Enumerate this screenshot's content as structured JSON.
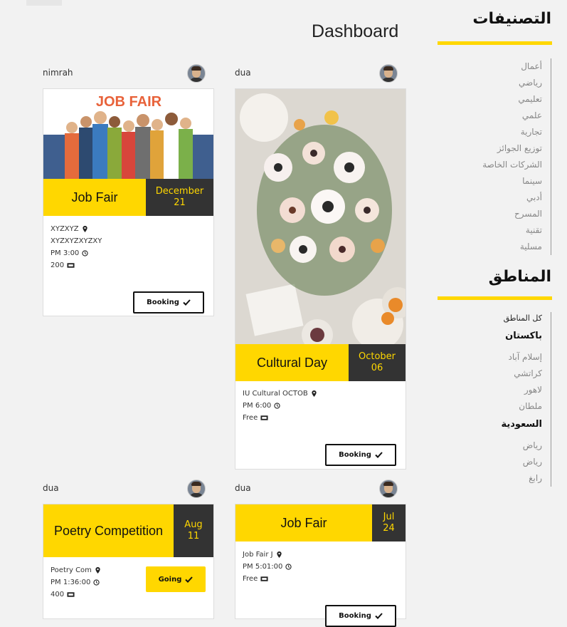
{
  "page": {
    "title": "Dashboard"
  },
  "sidebar": {
    "categories_heading": "التصنيفات",
    "categories": [
      "أعمال",
      "رياضي",
      "تعليمي",
      "علمي",
      "تجارية",
      "توزيع الجوائز",
      "الشركات الخاصة",
      "سينما",
      "أدبي",
      "المسرح",
      "تقنية",
      "مسلية"
    ],
    "regions_heading": "المناطق",
    "all_regions": "كل المناطق",
    "pakistan": "باكستان",
    "pakistan_cities": [
      "إسلام آباد",
      "كراتشي",
      "لاهور",
      "ملطان"
    ],
    "saudi": "السعودية",
    "saudi_cities": [
      "رياض",
      "رياض",
      "رابغ"
    ]
  },
  "cards": [
    {
      "author": "nimrah",
      "title": "Job Fair",
      "date_top": "December",
      "date_bottom": "21",
      "location": "XYZXYZ",
      "address": "XYZXYZXYZXY",
      "time": "PM 3:00",
      "price": "200",
      "button": "Booking",
      "image_text": "JOB FAIR"
    },
    {
      "author": "dua",
      "title": "Cultural Day",
      "date_top": "October",
      "date_bottom": "06",
      "location": "IU Cultural OCTOB",
      "time": "PM 6:00",
      "price": "Free",
      "button": "Booking"
    },
    {
      "author": "dua",
      "title": "Poetry Competition",
      "date_top": "Aug",
      "date_bottom": "11",
      "location": "Poetry Com",
      "time": "PM 1:36:00",
      "price": "400",
      "button": "Going"
    },
    {
      "author": "dua",
      "title": "Job Fair",
      "date_top": "Jul",
      "date_bottom": "24",
      "location": "Job Fair J",
      "time": "PM 5:01:00",
      "price": "Free",
      "button": "Booking"
    }
  ],
  "colors": {
    "accent": "#ffd700",
    "dark": "#333333",
    "background": "#f2f2f2"
  }
}
